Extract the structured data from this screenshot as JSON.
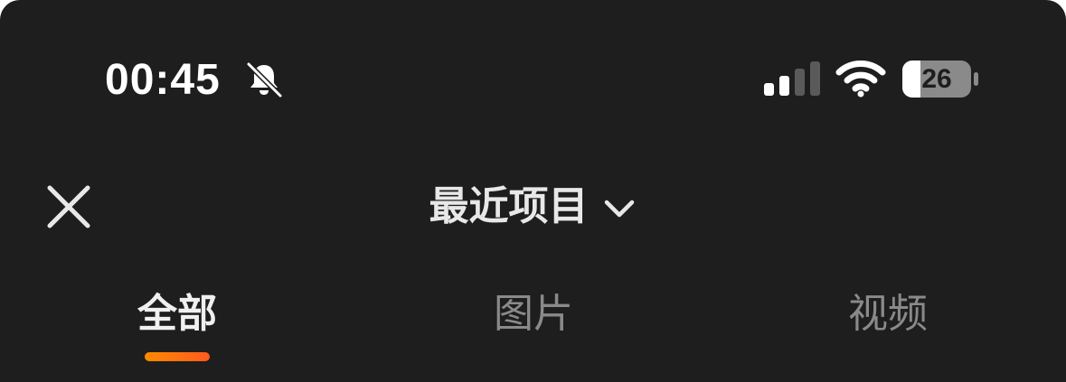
{
  "status_bar": {
    "time": "00:45",
    "battery_level": "26",
    "icons": {
      "silent": "bell-slash-icon",
      "signal": "cellular-signal-icon",
      "wifi": "wifi-icon",
      "battery": "battery-icon"
    }
  },
  "header": {
    "close_icon": "close-icon",
    "title": "最近项目",
    "title_chevron_icon": "chevron-down-icon"
  },
  "tabs": [
    {
      "label": "全部",
      "active": true
    },
    {
      "label": "图片",
      "active": false
    },
    {
      "label": "视频",
      "active": false
    }
  ],
  "colors": {
    "background": "#1e1e1e",
    "active_tab_indicator_start": "#ff8a00",
    "active_tab_indicator_end": "#ff5a1f",
    "inactive_tab_text": "#8a8a8a",
    "active_tab_text": "#f0f0f0"
  }
}
